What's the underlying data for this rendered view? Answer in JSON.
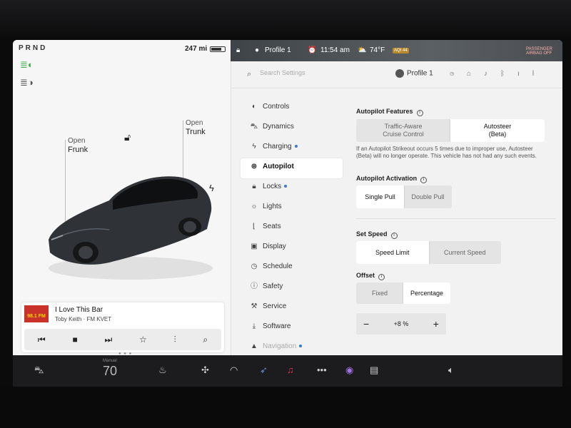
{
  "status": {
    "gear": "PRND",
    "range": "247 mi"
  },
  "car_panel": {
    "frunk_open": "Open",
    "frunk_label": "Frunk",
    "trunk_open": "Open",
    "trunk_label": "Trunk"
  },
  "media": {
    "album_text": "98.1 FM",
    "song": "I Love This Bar",
    "artist": "Toby Keith · FM KVET"
  },
  "topbar": {
    "profile": "Profile 1",
    "time": "11:54 am",
    "temp": "74°F",
    "aqi": "AQI 44",
    "airbag": "PASSENGER AIRBAG OFF"
  },
  "settings": {
    "search_placeholder": "Search Settings",
    "profile": "Profile 1",
    "menu": [
      {
        "label": "Controls"
      },
      {
        "label": "Dynamics"
      },
      {
        "label": "Charging"
      },
      {
        "label": "Autopilot"
      },
      {
        "label": "Locks"
      },
      {
        "label": "Lights"
      },
      {
        "label": "Seats"
      },
      {
        "label": "Display"
      },
      {
        "label": "Schedule"
      },
      {
        "label": "Safety"
      },
      {
        "label": "Service"
      },
      {
        "label": "Software"
      },
      {
        "label": "Navigation"
      }
    ],
    "autopilot_features": {
      "title": "Autopilot Features",
      "option1_line1": "Traffic-Aware",
      "option1_line2": "Cruise Control",
      "option2_line1": "Autosteer",
      "option2_line2": "(Beta)",
      "note": "If an Autopilot Strikeout occurs 5 times due to improper use, Autosteer (Beta) will no longer operate. This vehicle has not had any such events."
    },
    "activation": {
      "title": "Autopilot Activation",
      "option1": "Single Pull",
      "option2": "Double Pull"
    },
    "set_speed": {
      "title": "Set Speed",
      "option1": "Speed Limit",
      "option2": "Current Speed"
    },
    "offset": {
      "title": "Offset",
      "option1": "Fixed",
      "option2": "Percentage",
      "value": "+8 %"
    }
  },
  "dock": {
    "temp_label": "Manual",
    "temp_value": "70"
  }
}
